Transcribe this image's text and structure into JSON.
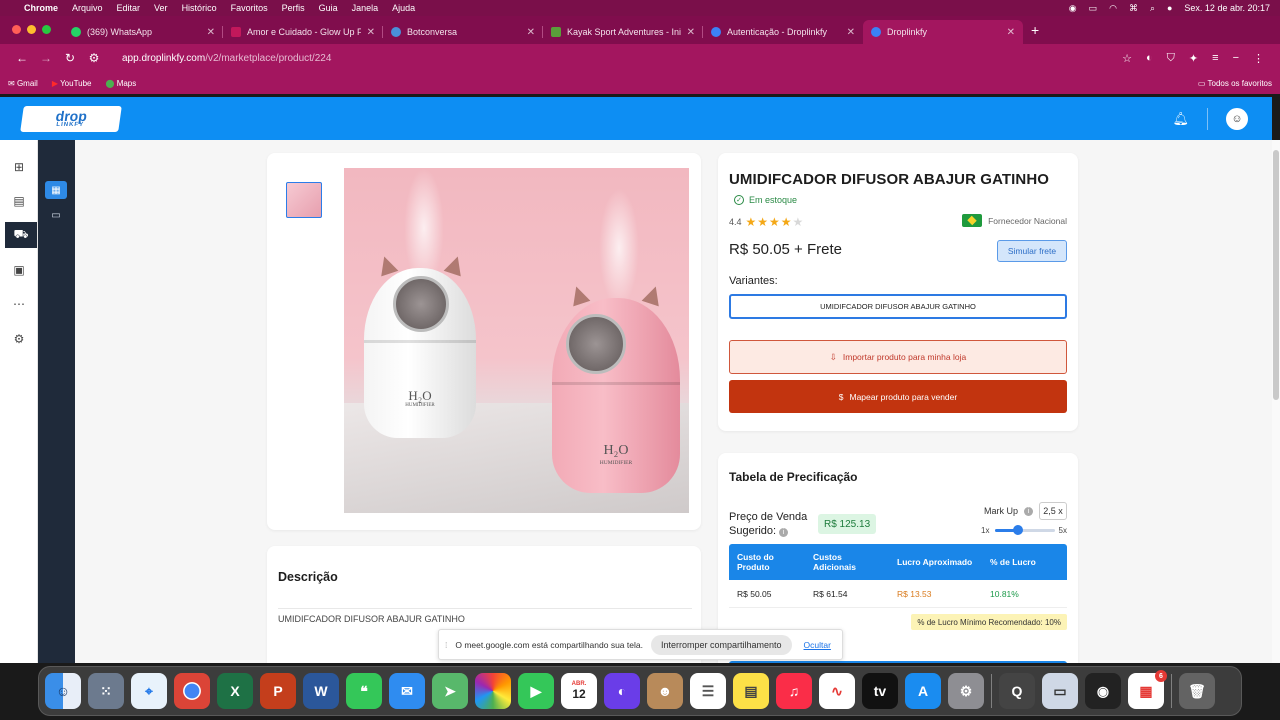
{
  "menubar": {
    "app": "Chrome",
    "items": [
      "Arquivo",
      "Editar",
      "Ver",
      "Histórico",
      "Favoritos",
      "Perfis",
      "Guia",
      "Janela",
      "Ajuda"
    ],
    "datetime": "Sex. 12 de abr.  20:17"
  },
  "tabs": [
    {
      "title": "(369) WhatsApp",
      "favicon_color": "#25d366"
    },
    {
      "title": "Amor e Cuidado - Glow Up Fe",
      "favicon_color": "#c2185b"
    },
    {
      "title": "Botconversa",
      "favicon_color": "#4a90d9"
    },
    {
      "title": "Kayak Sport Adventures - Inic",
      "favicon_color": "#5a9e3a"
    },
    {
      "title": "Autenticação - Droplinkfy",
      "favicon_color": "#3b82f6"
    },
    {
      "title": "Droplinkfy",
      "favicon_color": "#3b82f6"
    }
  ],
  "address": {
    "domain": "app.droplinkfy.com",
    "path": "/v2/marketplace/product/224"
  },
  "bookmarks": {
    "items": [
      "Gmail",
      "YouTube",
      "Maps"
    ],
    "all": "Todos os favoritos"
  },
  "header": {
    "logo_top": "drop",
    "logo_bottom": "LINKFY"
  },
  "product": {
    "title": "UMIDIFCADOR DIFUSOR ABAJUR GATINHO",
    "stock": "Em estoque",
    "rating": "4.4",
    "supplier": "Fornecedor Nacional",
    "price": "R$ 50.05 + Frete",
    "simulate": "Simular frete",
    "variants_label": "Variantes:",
    "variant": "UMIDIFCADOR DIFUSOR ABAJUR GATINHO",
    "import_btn": "Importar produto para minha loja",
    "map_btn": "Mapear produto para vender",
    "h2o": "H₂O",
    "humidifier": "HUMIDIFIER"
  },
  "pricing": {
    "title": "Tabela de Precificação",
    "suggested_label_1": "Preço de Venda",
    "suggested_label_2": "Sugerido:",
    "suggested_value": "R$ 125.13",
    "markup_label": "Mark Up",
    "markup_value": "2,5 x",
    "slider_min": "1x",
    "slider_max": "5x",
    "slider_fraction": 0.375,
    "headers": [
      "Custo do Produto",
      "Custos Adicionais",
      "Lucro Aproximado",
      "% de Lucro"
    ],
    "row": [
      "R$ 50.05",
      "R$ 61.54",
      "R$ 13.53",
      "10.81%"
    ],
    "min_profit": "% de Lucro Mínimo Recomendado: 10%"
  },
  "description": {
    "title": "Descrição",
    "text": "UMIDIFCADOR DIFUSOR ABAJUR GATINHO"
  },
  "share_bar": {
    "message": "O meet.google.com está compartilhando sua tela.",
    "stop": "Interromper compartilhamento",
    "hide": "Ocultar"
  },
  "dock": {
    "calendar_month": "ABR.",
    "calendar_day": "12",
    "badge": "6"
  }
}
